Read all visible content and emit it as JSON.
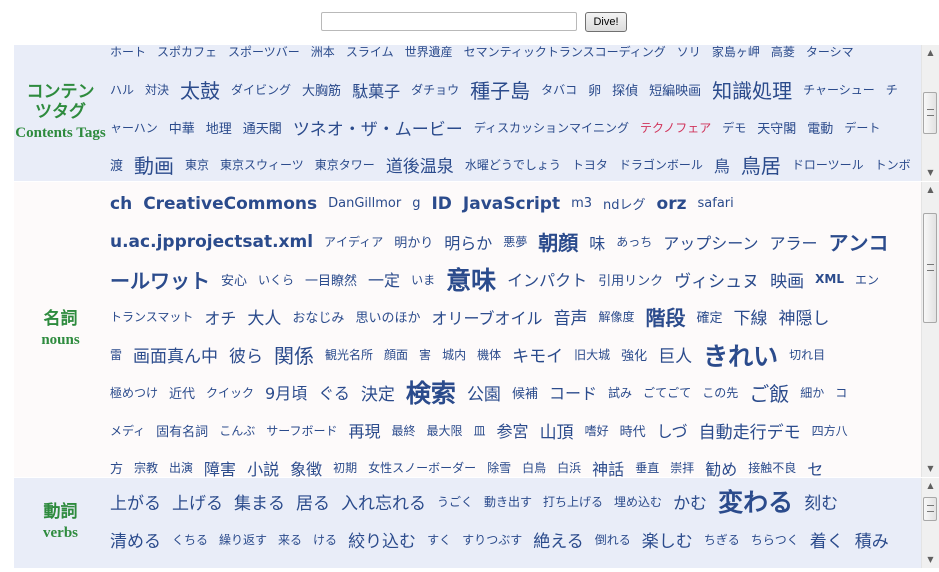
{
  "search": {
    "value": "",
    "button": "Dive!"
  },
  "colors": {
    "tag": "#2b4b8c",
    "highlight": "#d0335a",
    "label": "#2e8b3e"
  },
  "sections": [
    {
      "label_ja": "コンテンツタグ",
      "label_en": "Contents Tags",
      "bg": "#e9edf8",
      "scroll": 0.5,
      "lines": [
        [
          [
            "ホート",
            1
          ],
          [
            "スポカフェ",
            1
          ],
          [
            "スポーツバー",
            1
          ],
          [
            "洲本",
            1
          ],
          [
            "スライム",
            1
          ],
          [
            "世界遺産",
            1
          ],
          [
            "セマンティックトランスコーディング",
            1
          ],
          [
            "ソリ",
            1
          ],
          [
            "家島ヶ岬",
            1
          ],
          [
            "高菱",
            1
          ],
          [
            "ターシマ",
            1
          ]
        ],
        [
          [
            "ハル",
            1
          ],
          [
            "対決",
            1
          ],
          [
            "太鼓",
            5
          ],
          [
            "ダイビング",
            1
          ],
          [
            "大胸筋",
            2
          ],
          [
            "駄菓子",
            3
          ],
          [
            "ダチョウ",
            1
          ],
          [
            "種子島",
            5
          ],
          [
            "タバコ",
            1
          ],
          [
            "卵",
            2
          ],
          [
            "探偵",
            2
          ],
          [
            "短編映画",
            2
          ],
          [
            "知識処理",
            5
          ],
          [
            "チャーシュー",
            1
          ],
          [
            "チ",
            1
          ]
        ],
        [
          [
            "ャーハン",
            1
          ],
          [
            "中華",
            2
          ],
          [
            "地理",
            2
          ],
          [
            "通天閣",
            2
          ],
          [
            "ツネオ・ザ・ムービー",
            4
          ],
          [
            "ディスカッションマイニング",
            1
          ],
          [
            "テクノフェア",
            1,
            0,
            1
          ],
          [
            "デモ",
            1
          ],
          [
            "天守閣",
            2
          ],
          [
            "電動",
            2
          ],
          [
            "デート",
            1
          ]
        ],
        [
          [
            "渡",
            2
          ],
          [
            "動画",
            5
          ],
          [
            "東京",
            1
          ],
          [
            "東京スウィーツ",
            1
          ],
          [
            "東京タワー",
            1
          ],
          [
            "道後温泉",
            4
          ],
          [
            "水曜どうでしょう",
            1
          ],
          [
            "トヨタ",
            1
          ],
          [
            "ドラゴンボール",
            1
          ],
          [
            "鳥",
            3
          ],
          [
            "鳥居",
            5
          ],
          [
            "ドローツール",
            1
          ],
          [
            "トンボ",
            1
          ]
        ]
      ]
    },
    {
      "label_ja": "名詞",
      "label_en": "nouns",
      "bg": "#fdfafa",
      "scroll": 0.1,
      "lines": [
        [
          [
            "ch",
            4,
            1
          ],
          [
            "CreativeCommons",
            4,
            1
          ],
          [
            "DanGillmor",
            2
          ],
          [
            "g",
            2
          ],
          [
            "ID",
            4,
            1
          ],
          [
            "JavaScript",
            4,
            1
          ],
          [
            "m3",
            2
          ],
          [
            "ndレグ",
            2
          ],
          [
            "orz",
            4,
            1
          ],
          [
            "safari",
            2
          ]
        ],
        [
          [
            "u.ac.jpprojectsat.xml",
            4,
            1
          ],
          [
            "アイディア",
            1
          ],
          [
            "明かり",
            2
          ],
          [
            "明らか",
            3
          ],
          [
            "悪夢",
            1
          ],
          [
            "朝顔",
            5,
            1
          ],
          [
            "味",
            3
          ],
          [
            "あっち",
            1
          ],
          [
            "アップシーン",
            3
          ],
          [
            "アラー",
            3
          ],
          [
            "アンコ",
            5,
            1
          ]
        ],
        [
          [
            "ールワット",
            5,
            1
          ],
          [
            "安心",
            2
          ],
          [
            "いくら",
            1
          ],
          [
            "一目瞭然",
            2
          ],
          [
            "一定",
            3
          ],
          [
            "いま",
            1
          ],
          [
            "意味",
            6,
            1
          ],
          [
            "インパクト",
            3
          ],
          [
            "引用リンク",
            2
          ],
          [
            "ヴィシュヌ",
            4
          ],
          [
            "映画",
            4
          ],
          [
            "XML",
            1,
            1
          ],
          [
            "エン",
            1
          ]
        ],
        [
          [
            "トランスマット",
            1
          ],
          [
            "オチ",
            3
          ],
          [
            "大人",
            4
          ],
          [
            "おなじみ",
            2
          ],
          [
            "思いのほか",
            2
          ],
          [
            "オリーブオイル",
            3
          ],
          [
            "音声",
            4
          ],
          [
            "解像度",
            1
          ],
          [
            "階段",
            5,
            1
          ],
          [
            "確定",
            2
          ],
          [
            "下線",
            4
          ],
          [
            "神隠し",
            4
          ]
        ],
        [
          [
            "雷",
            1
          ],
          [
            "画面真ん中",
            4
          ],
          [
            "彼ら",
            4
          ],
          [
            "関係",
            5
          ],
          [
            "観光名所",
            1
          ],
          [
            "顔面",
            1
          ],
          [
            "害",
            1
          ],
          [
            "城内",
            1
          ],
          [
            "機体",
            1
          ],
          [
            "キモイ",
            4
          ],
          [
            "旧大城",
            1
          ],
          [
            "強化",
            2
          ],
          [
            "巨人",
            4
          ],
          [
            "きれい",
            6,
            1
          ],
          [
            "切れ目",
            1
          ]
        ],
        [
          [
            "極めつけ",
            1
          ],
          [
            "近代",
            2
          ],
          [
            "クイック",
            1
          ],
          [
            "9月頃",
            3
          ],
          [
            "ぐる",
            3
          ],
          [
            "決定",
            4
          ],
          [
            "検索",
            6,
            1
          ],
          [
            "公園",
            4
          ],
          [
            "候補",
            2
          ],
          [
            "コード",
            3
          ],
          [
            "試み",
            1
          ],
          [
            "ごてごて",
            1
          ],
          [
            "この先",
            1
          ],
          [
            "ご飯",
            5
          ],
          [
            "細か",
            1
          ],
          [
            "コ",
            1
          ]
        ],
        [
          [
            "メディ",
            1
          ],
          [
            "固有名詞",
            2
          ],
          [
            "こんぶ",
            1
          ],
          [
            "サーフボード",
            1
          ],
          [
            "再現",
            3
          ],
          [
            "最終",
            1
          ],
          [
            "最大限",
            1
          ],
          [
            "皿",
            1
          ],
          [
            "参宮",
            3
          ],
          [
            "山頂",
            4
          ],
          [
            "嗜好",
            1
          ],
          [
            "時代",
            2
          ],
          [
            "しづ",
            3
          ],
          [
            "自動走行デモ",
            4
          ],
          [
            "四方八",
            1
          ]
        ],
        [
          [
            "方",
            2
          ],
          [
            "宗教",
            1
          ],
          [
            "出演",
            1
          ],
          [
            "障害",
            3
          ],
          [
            "小説",
            3
          ],
          [
            "象徴",
            3
          ],
          [
            "初期",
            1
          ],
          [
            "女性スノーボーダー",
            1
          ],
          [
            "除雪",
            1
          ],
          [
            "白鳥",
            1
          ],
          [
            "白浜",
            1
          ],
          [
            "神話",
            3
          ],
          [
            "垂直",
            1
          ],
          [
            "崇拝",
            1
          ],
          [
            "勧め",
            3
          ],
          [
            "接触不良",
            1
          ],
          [
            "セ",
            3
          ]
        ]
      ]
    },
    {
      "label_ja": "動詞",
      "label_en": "verbs",
      "bg": "#e9edf8",
      "scroll": 0.1,
      "lines": [
        [
          [
            "上がる",
            4
          ],
          [
            "上げる",
            4
          ],
          [
            "集まる",
            4
          ],
          [
            "居る",
            4
          ],
          [
            "入れ忘れる",
            4
          ],
          [
            "うごく",
            1
          ],
          [
            "動き出す",
            1
          ],
          [
            "打ち上げる",
            1
          ],
          [
            "埋め込む",
            1
          ],
          [
            "かむ",
            4
          ],
          [
            "変わる",
            6,
            1
          ],
          [
            "刻む",
            4
          ]
        ],
        [
          [
            "清める",
            4
          ],
          [
            "くちる",
            1
          ],
          [
            "繰り返す",
            1
          ],
          [
            "来る",
            1
          ],
          [
            "ける",
            1
          ],
          [
            "絞り込む",
            4
          ],
          [
            "すく",
            1
          ],
          [
            "すりつぶす",
            1
          ],
          [
            "絶える",
            4
          ],
          [
            "倒れる",
            1
          ],
          [
            "楽しむ",
            4
          ],
          [
            "ちぎる",
            1
          ],
          [
            "ちらつく",
            1
          ],
          [
            "着く",
            4
          ],
          [
            "積み",
            4
          ]
        ]
      ]
    }
  ]
}
